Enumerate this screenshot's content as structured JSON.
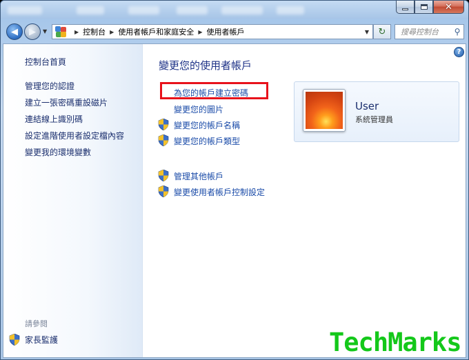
{
  "address_bar": {
    "crumbs": [
      "控制台",
      "使用者帳戶和家庭安全",
      "使用者帳戶"
    ]
  },
  "search": {
    "placeholder": "搜尋控制台"
  },
  "sidebar": {
    "home_label": "控制台首頁",
    "links": [
      "管理您的認證",
      "建立一張密碼重設磁片",
      "連結線上識別碼",
      "設定進階使用者設定檔內容",
      "變更我的環境變數"
    ],
    "see_also_label": "請參閱",
    "see_also_links": [
      "家長監護"
    ]
  },
  "main": {
    "heading": "變更您的使用者帳戶",
    "tasks": [
      {
        "label": "為您的帳戶建立密碼",
        "shield": false
      },
      {
        "label": "變更您的圖片",
        "shield": false
      },
      {
        "label": "變更您的帳戶名稱",
        "shield": true
      },
      {
        "label": "變更您的帳戶類型",
        "shield": true
      }
    ],
    "other_tasks": [
      {
        "label": "管理其他帳戶",
        "shield": true
      },
      {
        "label": "變更使用者帳戶控制設定",
        "shield": true
      }
    ]
  },
  "user_card": {
    "name": "User",
    "role": "系統管理員"
  },
  "highlight_color": "#e8121b",
  "watermark": {
    "text": "TechMarks",
    "color": "#14c81a"
  },
  "icons": [
    "back-arrow-icon",
    "forward-arrow-icon",
    "control-panel-icon",
    "refresh-icon",
    "search-icon",
    "help-icon",
    "uac-shield-icon",
    "user-picture-flower"
  ]
}
